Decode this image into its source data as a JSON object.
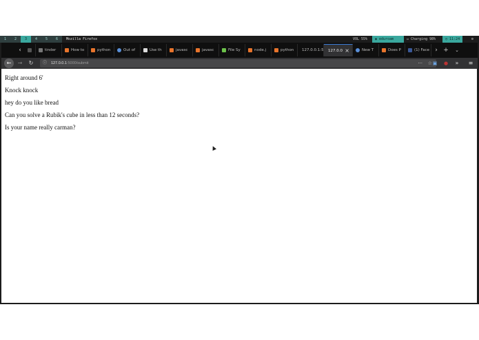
{
  "statusbar": {
    "workspaces": [
      "1",
      "2",
      "3",
      "4",
      "5",
      "6"
    ],
    "active_workspace_index": 2,
    "window_title": "Mozilla Firefox",
    "volume": "VOL 55%",
    "wifi": "eduroam",
    "battery": "Charging 98%",
    "clock": "11:24",
    "colors": {
      "accent": "#3aa89e",
      "background": "#1c1c1c"
    }
  },
  "tabs": [
    {
      "label": "tinder",
      "icon": "blank-icon",
      "icon_color": "#777777"
    },
    {
      "label": "How to",
      "icon": "stackoverflow-icon",
      "icon_color": "#e8742c"
    },
    {
      "label": "python",
      "icon": "stackoverflow-icon",
      "icon_color": "#e8742c"
    },
    {
      "label": "Out of",
      "icon": "globe-icon",
      "icon_color": "#5a8fd8"
    },
    {
      "label": "Use th",
      "icon": "page-icon",
      "icon_color": "#dddddd"
    },
    {
      "label": "javasc",
      "icon": "stackoverflow-icon",
      "icon_color": "#e8742c"
    },
    {
      "label": "javasc",
      "icon": "stackoverflow-icon",
      "icon_color": "#e8742c"
    },
    {
      "label": "File Sy",
      "icon": "nodejs-icon",
      "icon_color": "#6cc24a"
    },
    {
      "label": "node.j",
      "icon": "stackoverflow-icon",
      "icon_color": "#e8742c"
    },
    {
      "label": "python",
      "icon": "stackoverflow-icon",
      "icon_color": "#e8742c"
    },
    {
      "label": "127.0.0.1:5",
      "icon": "none",
      "icon_color": ""
    },
    {
      "label": "127.0.0",
      "icon": "none",
      "icon_color": "",
      "active": true
    },
    {
      "label": "New T",
      "icon": "firefox-icon",
      "icon_color": "#5a8fd8"
    },
    {
      "label": "Does P",
      "icon": "stackoverflow-icon",
      "icon_color": "#e8742c"
    },
    {
      "label": "(1) Face",
      "icon": "facebook-icon",
      "icon_color": "#3b5998"
    }
  ],
  "navbar": {
    "url_host": "127.0.0.1",
    "url_path": ":5000/submit"
  },
  "messages": [
    "Right around 6'",
    "Knock knock",
    "hey do you like bread",
    "Can you solve a Rubik's cube in less than 12 seconds?",
    "Is your name really carman?"
  ]
}
